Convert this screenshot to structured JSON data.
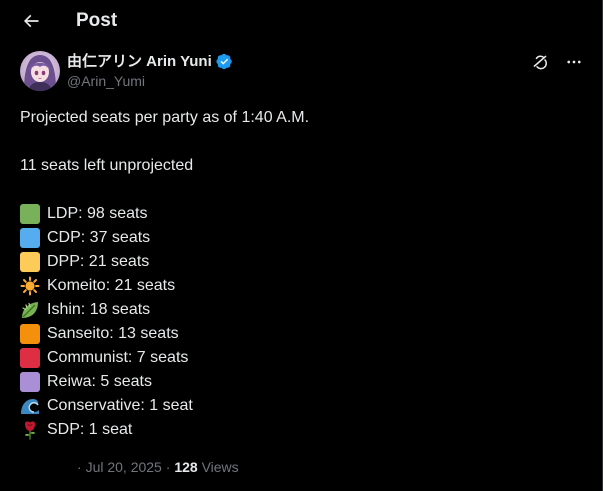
{
  "header": {
    "title": "Post"
  },
  "author": {
    "display_name": "由仁アリン Arin Yuni",
    "handle": "@Arin_Yumi"
  },
  "post": {
    "line1": "Projected seats per party as of 1:40 A.M.",
    "line2": "11 seats left unprojected",
    "parties": [
      {
        "icon": "green-square",
        "color": "#78b159",
        "text": "LDP: 98 seats"
      },
      {
        "icon": "blue-square",
        "color": "#55acee",
        "text": "CDP: 37 seats"
      },
      {
        "icon": "yellow-square",
        "color": "#fdcb58",
        "text": "DPP: 21 seats"
      },
      {
        "icon": "sun-icon",
        "color": "#ffac33",
        "text": "Komeito: 21 seats"
      },
      {
        "icon": "leaf-icon",
        "color": "#77b255",
        "text": "Ishin: 18 seats"
      },
      {
        "icon": "orange-square",
        "color": "#f4900c",
        "text": "Sanseito: 13 seats"
      },
      {
        "icon": "red-square",
        "color": "#dd2e44",
        "text": "Communist: 7 seats"
      },
      {
        "icon": "purple-square",
        "color": "#aa8ed6",
        "text": "Reiwa: 5 seats"
      },
      {
        "icon": "wave-icon",
        "color": "#3b88c3",
        "text": "Conservative: 1 seat"
      },
      {
        "icon": "rose-icon",
        "color": "#be1931",
        "text": "SDP: 1 seat"
      }
    ]
  },
  "meta": {
    "separator": "·",
    "date": "Jul 20, 2025",
    "views_count": "128",
    "views_label": "Views"
  },
  "colors": {
    "background": "#000000",
    "text": "#e7e9ea",
    "secondary": "#71767b",
    "verified": "#1d9bf0"
  }
}
